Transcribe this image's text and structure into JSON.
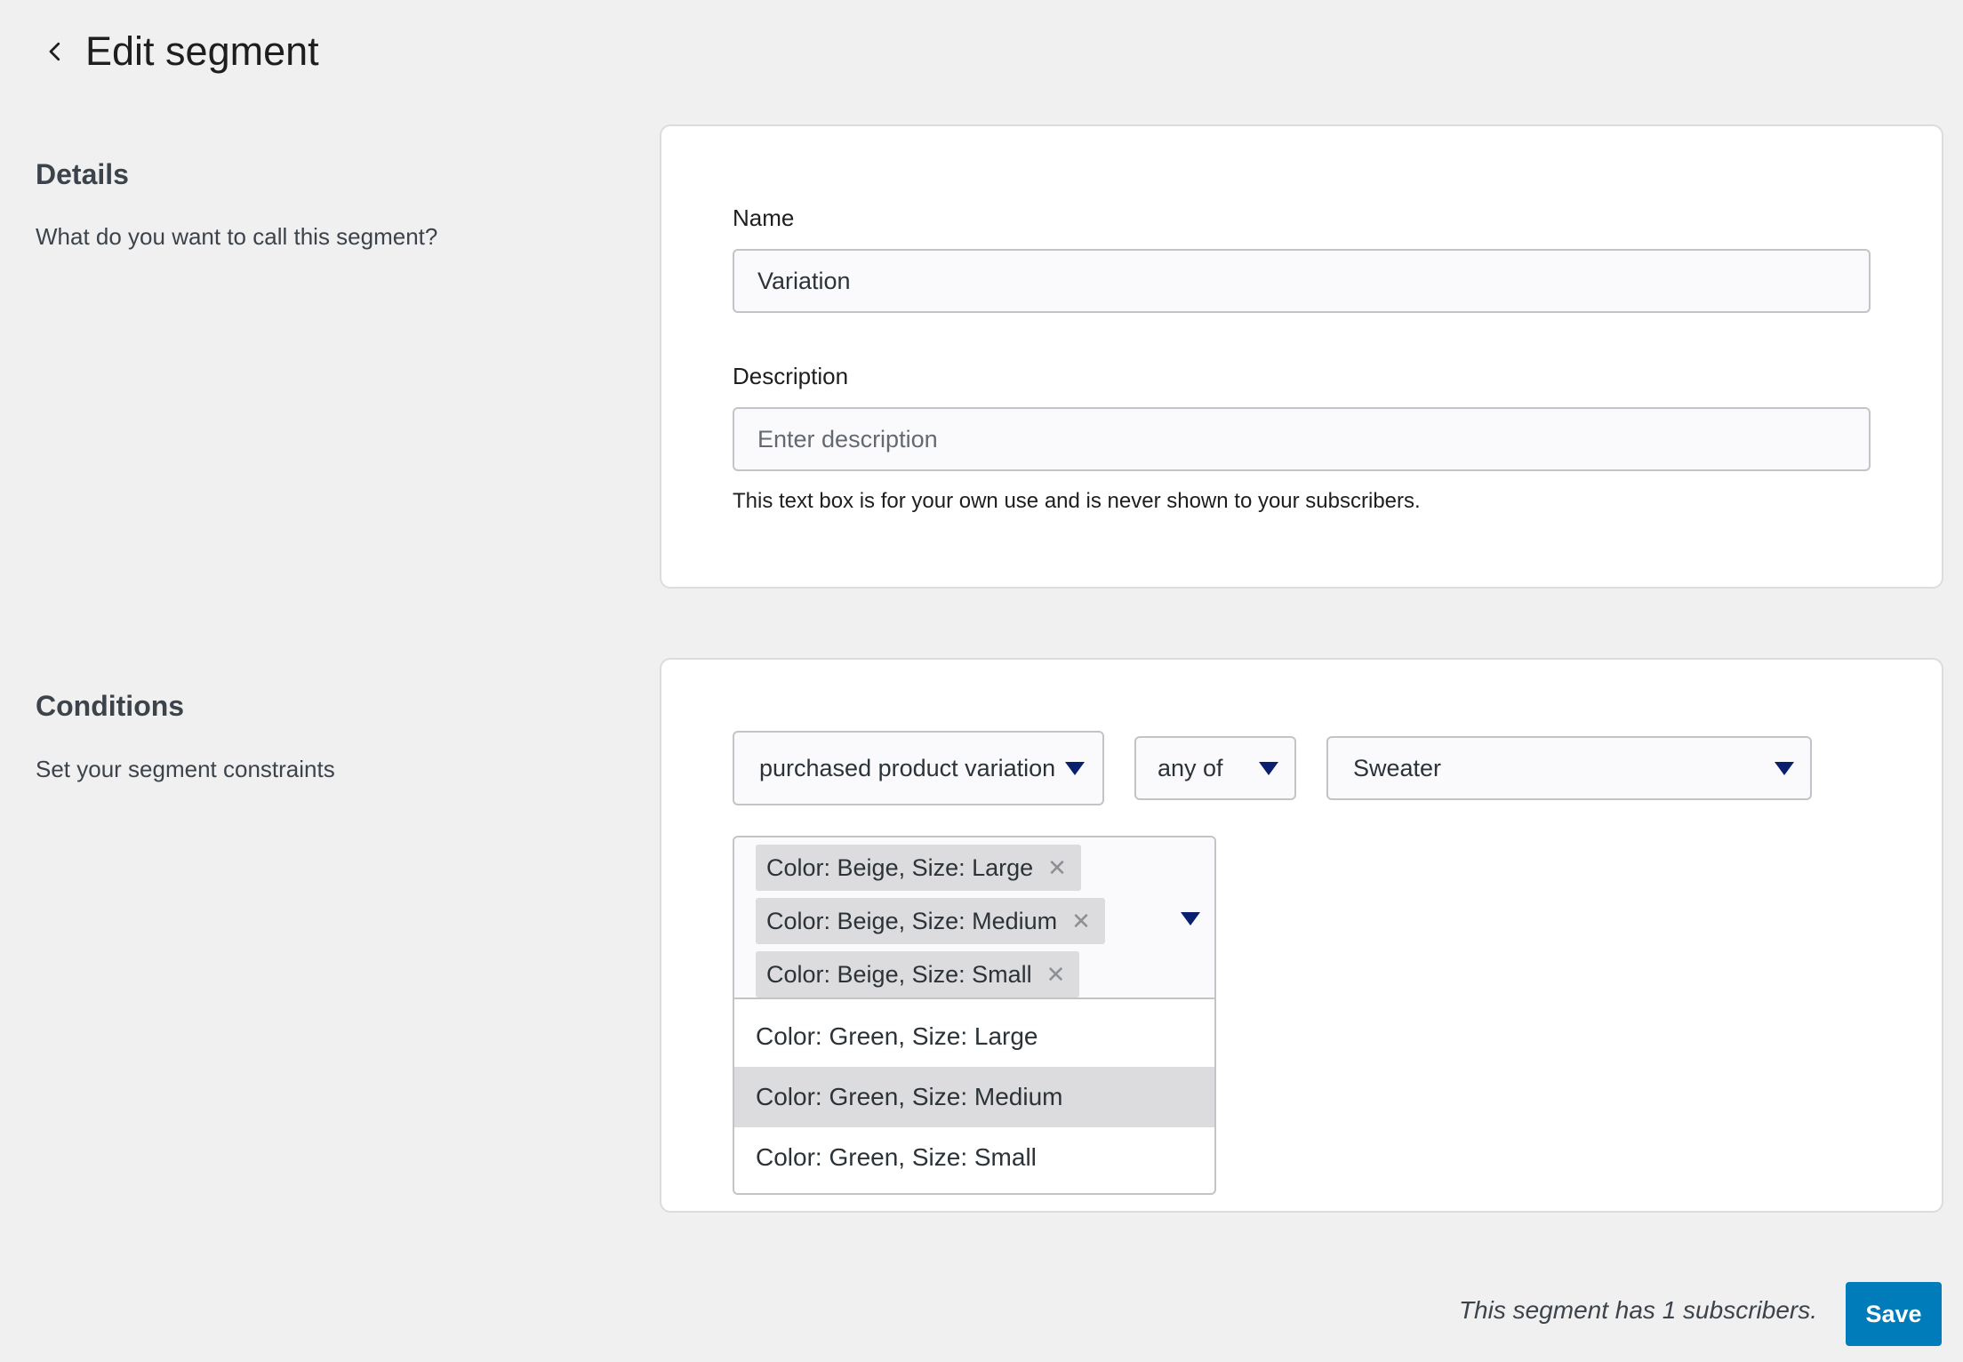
{
  "header": {
    "title": "Edit segment",
    "back_icon": "chevron-left-icon"
  },
  "details": {
    "heading": "Details",
    "description": "What do you want to call this segment?",
    "name_label": "Name",
    "name_value": "Variation",
    "description_label": "Description",
    "description_placeholder": "Enter description",
    "help_text": "This text box is for your own use and is never shown to your subscribers."
  },
  "conditions": {
    "heading": "Conditions",
    "description": "Set your segment constraints",
    "action_select": "purchased product variation",
    "operator_select": "any of",
    "product_select": "Sweater",
    "selected_tags": [
      "Color: Beige, Size: Large",
      "Color: Beige, Size: Medium",
      "Color: Beige, Size: Small"
    ],
    "options": [
      "Color: Green, Size: Large",
      "Color: Green, Size: Medium",
      "Color: Green, Size: Small"
    ],
    "highlighted_option": "Color: Green, Size: Medium",
    "remove_icon": "x-icon",
    "caret_icon": "caret-down-icon"
  },
  "footer": {
    "subscriber_text": "This segment has 1 subscribers.",
    "save_label": "Save"
  },
  "colors": {
    "background": "#f0f0f1",
    "primary": "#007cba",
    "caret": "#0a1f6e"
  }
}
